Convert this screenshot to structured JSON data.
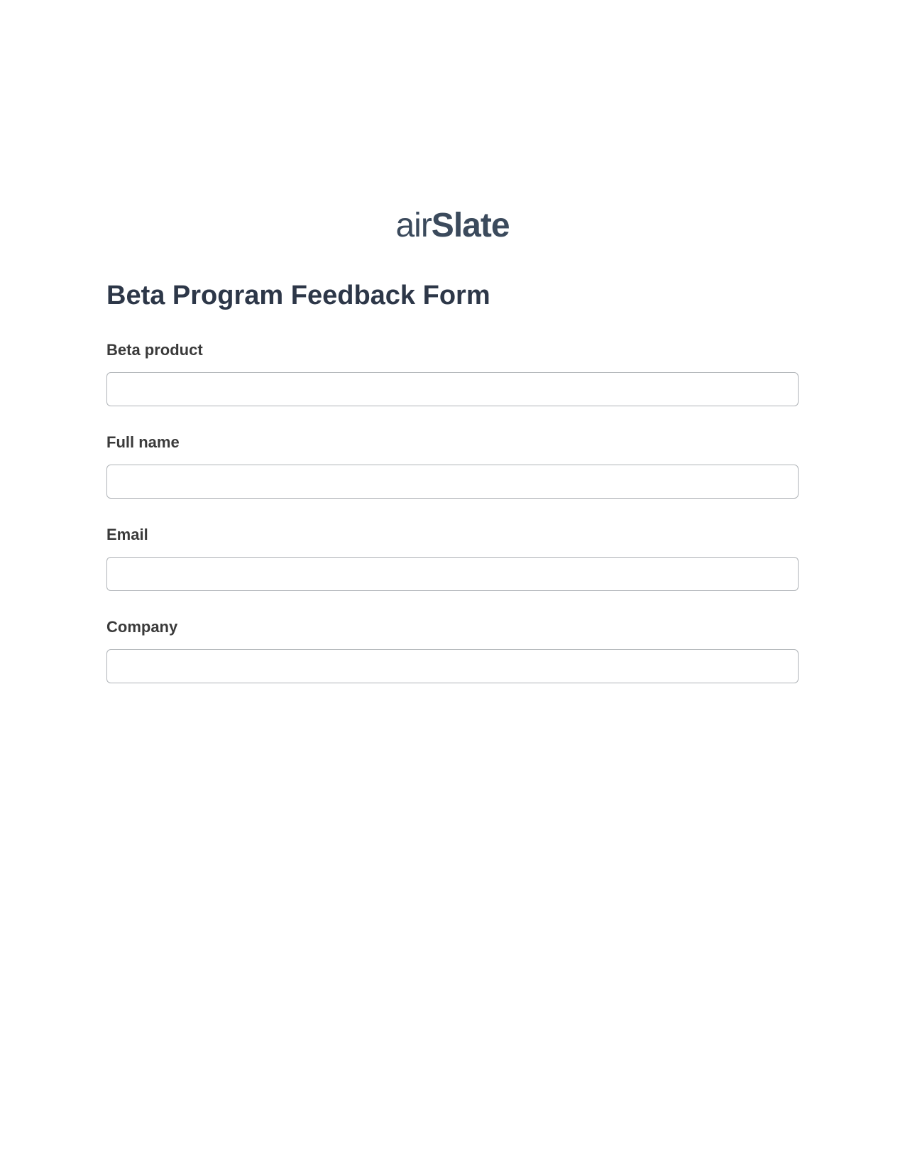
{
  "logo": {
    "part1": "air",
    "part2": "Slate"
  },
  "form": {
    "title": "Beta Program Feedback Form",
    "fields": [
      {
        "label": "Beta product",
        "value": ""
      },
      {
        "label": "Full name",
        "value": ""
      },
      {
        "label": "Email",
        "value": ""
      },
      {
        "label": "Company",
        "value": ""
      }
    ]
  }
}
